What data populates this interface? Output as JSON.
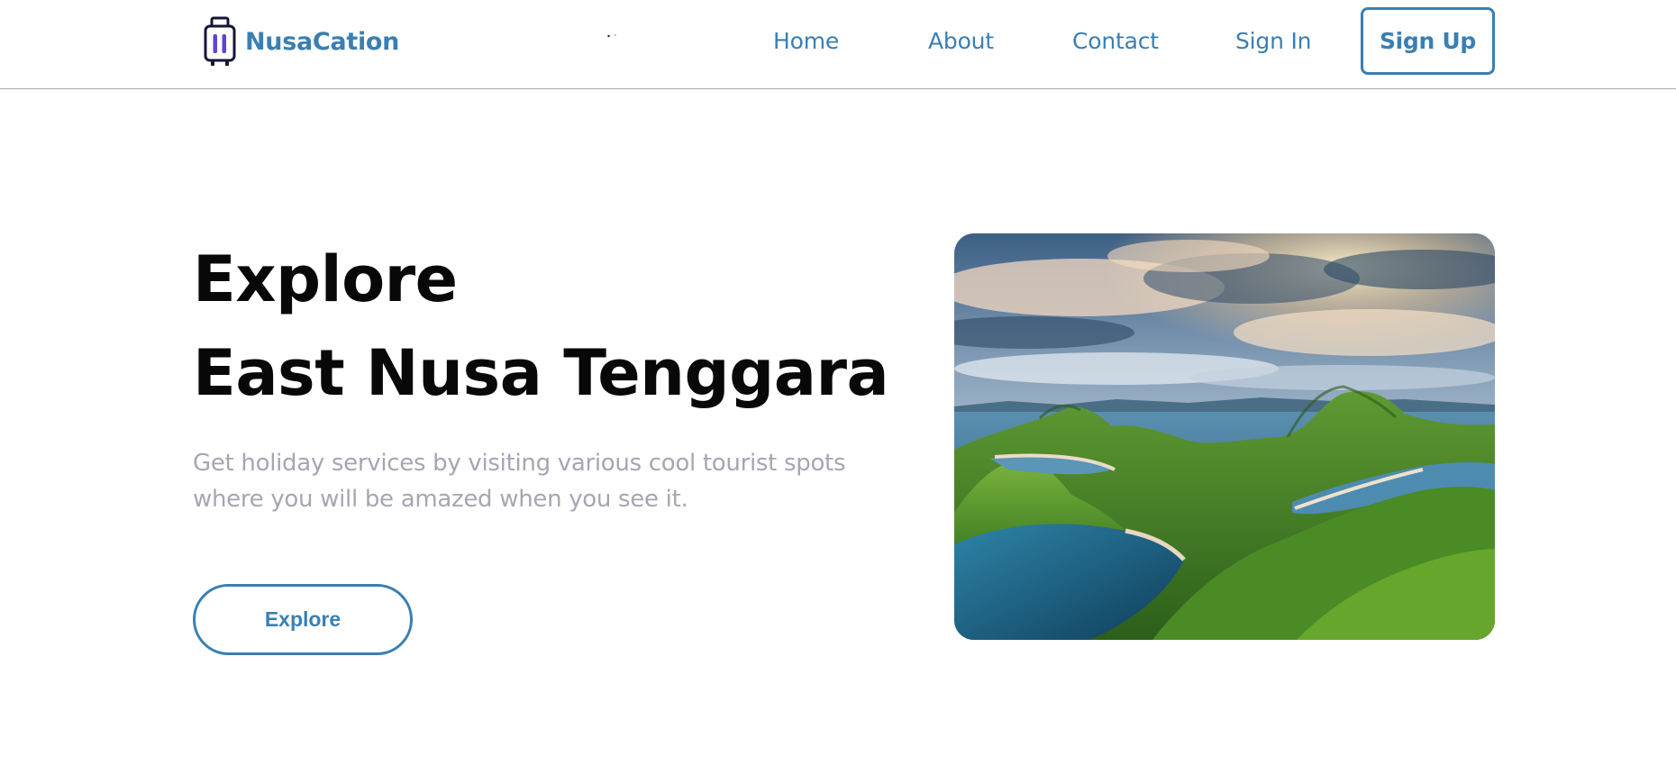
{
  "brand": {
    "name": "NusaCation",
    "logo_icon": "suitcase-icon",
    "accent": "#3a7fb2"
  },
  "nav": {
    "home": "Home",
    "about": "About",
    "contact": "Contact",
    "sign_in": "Sign In",
    "sign_up": "Sign Up"
  },
  "hero": {
    "title_line1": "Explore",
    "title_line2": "East Nusa Tenggara",
    "subtitle": "Get holiday services by visiting various cool tourist spots where you will be amazed when you see it.",
    "cta": "Explore",
    "image": "landscape-photo-islands"
  }
}
